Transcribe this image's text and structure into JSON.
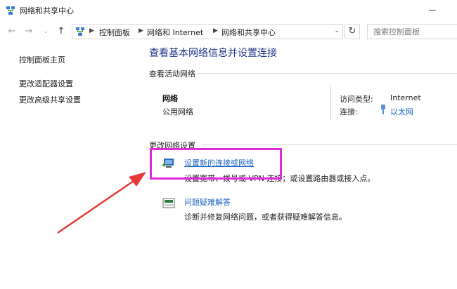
{
  "window": {
    "title": "网络和共享中心"
  },
  "address": {
    "crumbs": [
      "控制面板",
      "网络和 Internet",
      "网络和共享中心"
    ],
    "search_placeholder": "搜索控制面板"
  },
  "sidebar": {
    "items": [
      {
        "label": "控制面板主页"
      },
      {
        "label": "更改适配器设置"
      },
      {
        "label": "更改高级共享设置"
      }
    ]
  },
  "main": {
    "title": "查看基本网络信息并设置连接",
    "active_section": "查看活动网络",
    "network": {
      "name": "网络",
      "type": "公用网络",
      "access_label": "访问类型:",
      "access_value": "Internet",
      "connection_label": "连接:",
      "connection_value": "以太网"
    },
    "change_section": "更改网络设置",
    "tasks": [
      {
        "icon": "new-connection-icon",
        "link": "设置新的连接或网络",
        "desc": "设置宽带、拨号或 VPN 连接；或设置路由器或接入点。"
      },
      {
        "icon": "troubleshoot-icon",
        "link": "问题疑难解答",
        "desc": "诊断并修复网络问题，或者获得疑难解答信息。"
      }
    ]
  },
  "annotation": {
    "highlight_color": "#e22ad9",
    "arrow_color": "#e53935"
  }
}
